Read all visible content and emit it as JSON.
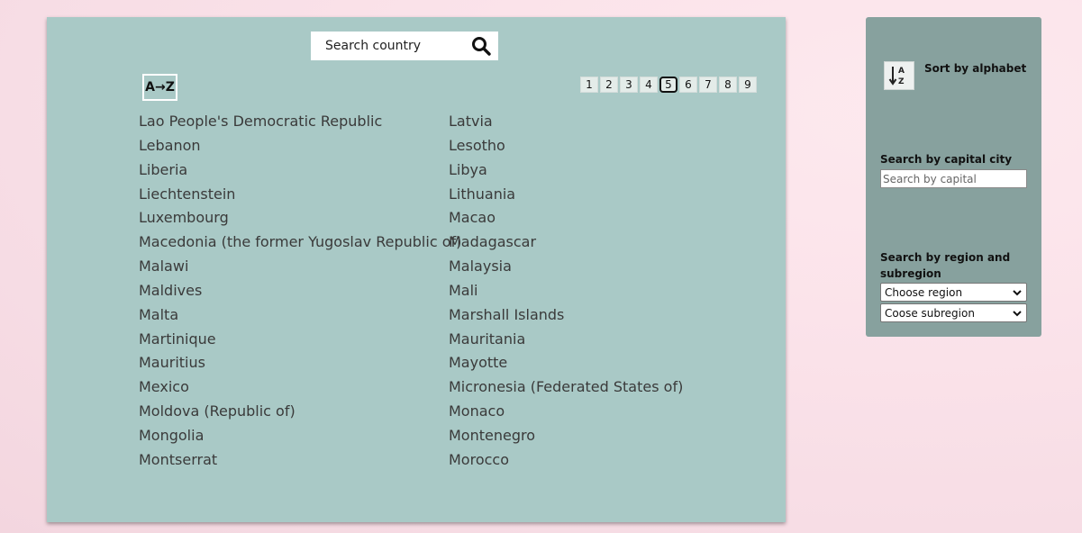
{
  "search": {
    "placeholder": "Search country"
  },
  "sort_toggle_label": "A→Z",
  "pagination": {
    "pages": [
      "1",
      "2",
      "3",
      "4",
      "5",
      "6",
      "7",
      "8",
      "9"
    ],
    "active": "5"
  },
  "countries_left": [
    "Lao People's Democratic Republic",
    "Lebanon",
    "Liberia",
    "Liechtenstein",
    "Luxembourg",
    "Macedonia (the former Yugoslav Republic of)",
    "Malawi",
    "Maldives",
    "Malta",
    "Martinique",
    "Mauritius",
    "Mexico",
    "Moldova (Republic of)",
    "Mongolia",
    "Montserrat"
  ],
  "countries_right": [
    "Latvia",
    "Lesotho",
    "Libya",
    "Lithuania",
    "Macao",
    "Madagascar",
    "Malaysia",
    "Mali",
    "Marshall Islands",
    "Mauritania",
    "Mayotte",
    "Micronesia (Federated States of)",
    "Monaco",
    "Montenegro",
    "Morocco"
  ],
  "sidebar": {
    "sort_label": "Sort by alphabet",
    "capital_label": "Search by capital city",
    "capital_placeholder": "Search by capital",
    "region_label": "Search by region and subregion",
    "region_select": "Choose region",
    "subregion_select": "Coose subregion"
  },
  "icons": {
    "search": "search-icon",
    "sort": "sort-alpha-down-icon",
    "chevron": "chevron-down-icon"
  },
  "colors": {
    "main_panel": "#a9c9c6",
    "side_panel": "#87a19e",
    "background": "#fbe3ea"
  }
}
